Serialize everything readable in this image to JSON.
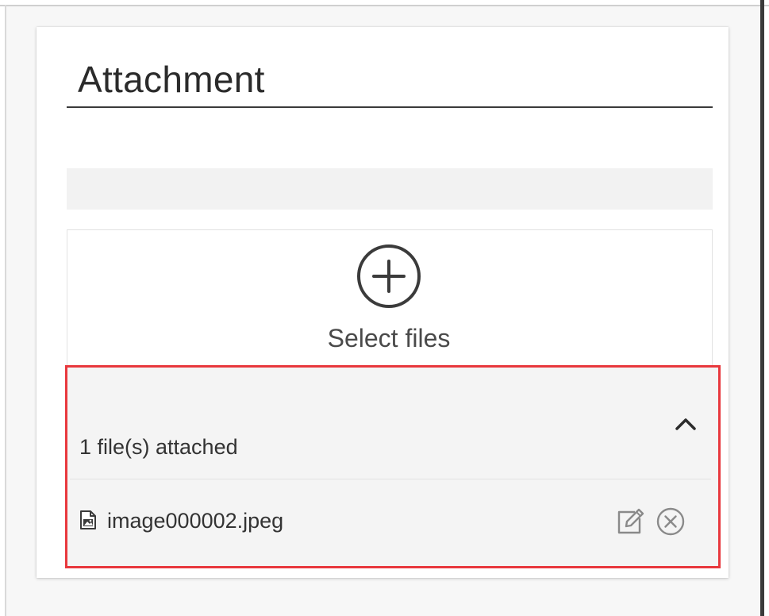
{
  "section": {
    "title": "Attachment"
  },
  "uploader": {
    "add_icon": "plus-circle-icon",
    "select_label": "Select files"
  },
  "attachments": {
    "count_label": "1 file(s) attached",
    "toggle_icon": "chevron-up-icon",
    "highlight_color": "#e8383d",
    "files": [
      {
        "name": "image000002.jpeg",
        "type_icon": "image-file-icon",
        "actions": [
          "edit-icon",
          "remove-icon"
        ]
      }
    ]
  }
}
